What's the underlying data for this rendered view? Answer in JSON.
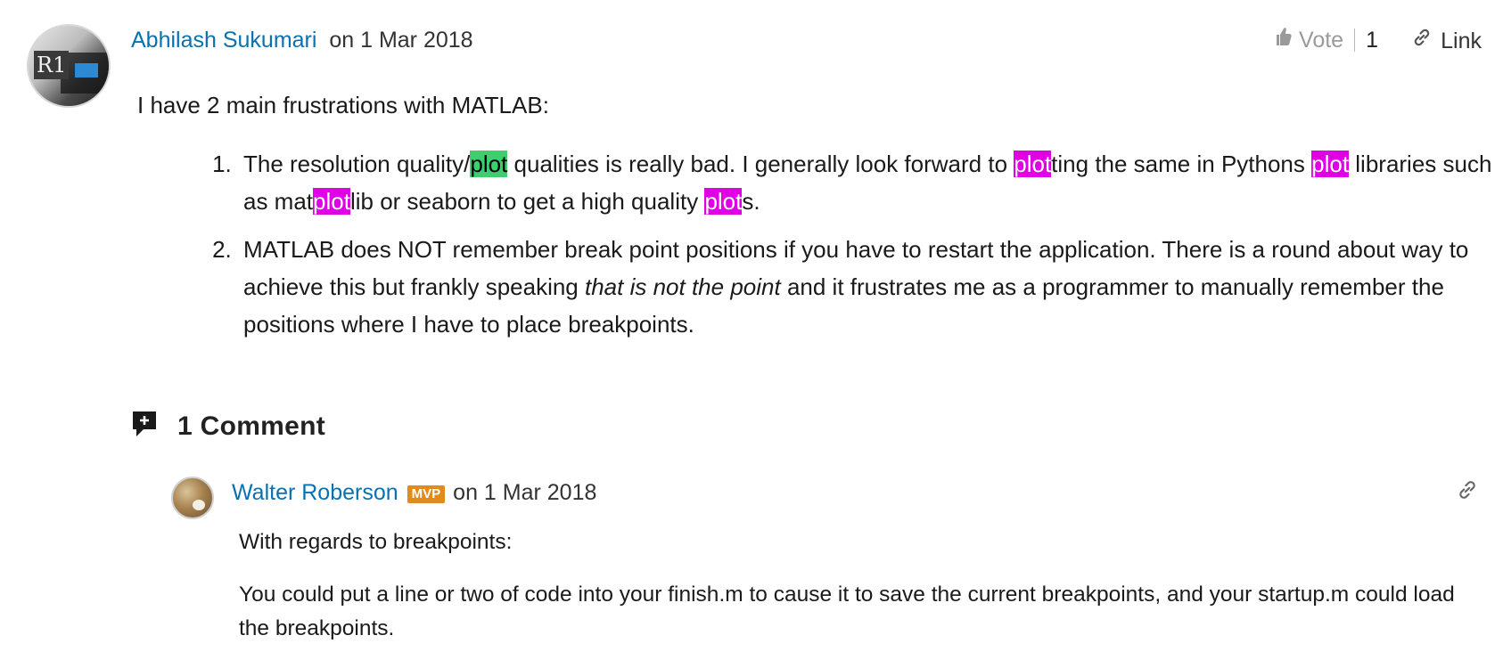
{
  "answer": {
    "author": "Abhilash Sukumari",
    "date_text": "on 1 Mar 2018",
    "vote_label": "Vote",
    "vote_count": "1",
    "link_label": "Link",
    "intro": "I have 2 main frustrations with MATLAB:",
    "points": [
      {
        "segments": [
          {
            "text": "The resolution quality/",
            "hl": ""
          },
          {
            "text": "plot",
            "hl": "green"
          },
          {
            "text": " qualities is really bad. I generally look forward to ",
            "hl": ""
          },
          {
            "text": "plot",
            "hl": "magenta"
          },
          {
            "text": "ting the same in Pythons ",
            "hl": ""
          },
          {
            "text": "plot",
            "hl": "magenta"
          },
          {
            "text": " libraries such as mat",
            "hl": ""
          },
          {
            "text": "plot",
            "hl": "magenta"
          },
          {
            "text": "lib or seaborn to get a high quality ",
            "hl": ""
          },
          {
            "text": "plot",
            "hl": "magenta"
          },
          {
            "text": "s.",
            "hl": ""
          }
        ]
      },
      {
        "segments": [
          {
            "text": "MATLAB does NOT remember break point positions if you have to restart the application. There is a round about way to achieve this but frankly speaking ",
            "hl": ""
          },
          {
            "text": "that is not the point",
            "hl": "",
            "italic": true
          },
          {
            "text": " and it frustrates me as a programmer to manually remember the positions where I have to place breakpoints.",
            "hl": ""
          }
        ]
      }
    ]
  },
  "comments": {
    "title": "1 Comment",
    "items": [
      {
        "author": "Walter Roberson",
        "badge": "MVP",
        "date_text": "on 1 Mar 2018",
        "paragraphs": [
          "With regards to breakpoints:",
          "You could put a line or two of code into your finish.m to cause it to save the current breakpoints, and your startup.m could load the breakpoints."
        ]
      }
    ]
  },
  "icons": {
    "vote": "thumbs-up-icon",
    "link": "link-icon",
    "comment": "comment-add-icon"
  },
  "colors": {
    "link_blue": "#0a71b0",
    "highlight_green": "#3dce6e",
    "highlight_magenta": "#e000e5",
    "mvp_orange": "#e08b1c"
  }
}
